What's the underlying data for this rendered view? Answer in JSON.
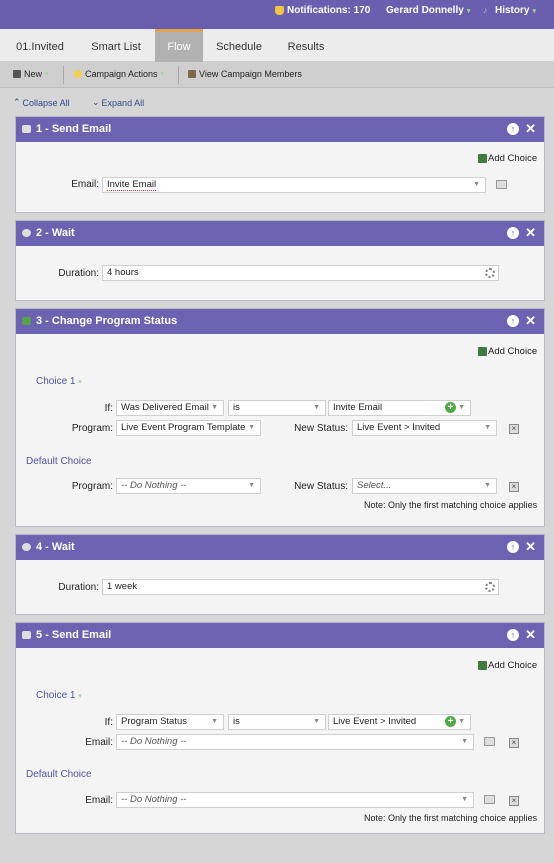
{
  "topbar": {
    "notifications": "Notifications: 170",
    "user": "Gerard Donnelly",
    "history": "History"
  },
  "tabs": [
    "01.Invited",
    "Smart List",
    "Flow",
    "Schedule",
    "Results"
  ],
  "active_tab": "Flow",
  "toolbar": {
    "new": "New",
    "campaign_actions": "Campaign Actions",
    "view_members": "View Campaign Members"
  },
  "collapse_all": "Collapse All",
  "expand_all": "Expand All",
  "add_choice": "Add Choice",
  "steps": {
    "s1": {
      "title": "1 - Send Email",
      "email_label": "Email:",
      "email_value": "Invite Email"
    },
    "s2": {
      "title": "2 - Wait",
      "duration_label": "Duration:",
      "duration_value": "4 hours"
    },
    "s3": {
      "title": "3 - Change Program Status",
      "choice1": "Choice 1",
      "if_label": "If:",
      "if_field": "Was Delivered Email",
      "if_op": "is",
      "if_value": "Invite Email",
      "program_label": "Program:",
      "program_value": "Live Event Program Template",
      "new_status_label": "New Status:",
      "new_status_value": "Live Event > Invited",
      "default_choice": "Default Choice",
      "default_program": "-- Do Nothing --",
      "default_status": "Select...",
      "note": "Note: Only the first matching choice applies"
    },
    "s4": {
      "title": "4 - Wait",
      "duration_label": "Duration:",
      "duration_value": "1 week"
    },
    "s5": {
      "title": "5 - Send Email",
      "choice1": "Choice 1",
      "if_label": "If:",
      "if_field": "Program Status",
      "if_op": "is",
      "if_value": "Live Event > Invited",
      "email_label": "Email:",
      "email_value": "-- Do Nothing --",
      "default_choice": "Default Choice",
      "default_email": "-- Do Nothing --",
      "note": "Note: Only the first matching choice applies"
    }
  },
  "colors": {
    "header": "#6a5fae",
    "tab_active": "#b1b1b1",
    "tab_accent": "#e5a24e",
    "choice_label": "#5252a0"
  }
}
